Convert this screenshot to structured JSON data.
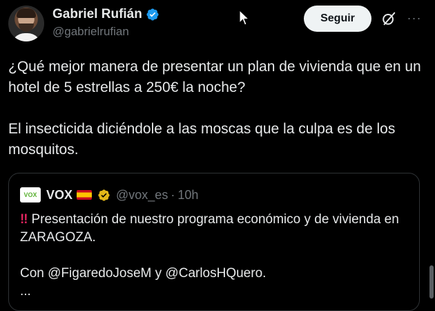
{
  "author": {
    "display_name": "Gabriel Rufián",
    "handle": "@gabrielrufian"
  },
  "actions": {
    "follow_label": "Seguir",
    "more_label": "···"
  },
  "tweet": {
    "paragraph_1": "¿Qué mejor manera de presentar un plan de vivienda que en un hotel de 5 estrellas a 250€ la noche?",
    "paragraph_2": "El insecticida diciéndole a las moscas que la culpa es de los mosquitos."
  },
  "quote": {
    "logo_text": "VOX",
    "name": "VOX",
    "handle": "@vox_es",
    "separator": "·",
    "time": "10h",
    "emoji": "‼",
    "line_1": "Presentación de nuestro programa económico y de vivienda en ZARAGOZA.",
    "line_2": "Con @FigaredoJoseM y @CarlosHQuero.",
    "line_3": "..."
  },
  "colors": {
    "background": "#000000",
    "text_primary": "#e7e9ea",
    "text_secondary": "#71767b",
    "verified_blue": "#1d9bf0",
    "verified_gold": "#e2b719",
    "button_bg": "#eff3f4",
    "border": "#2f3336"
  },
  "icons": {
    "verified": "verified-badge-icon",
    "grok": "grok-icon",
    "more": "more-icon",
    "cursor": "mouse-cursor-icon",
    "flag": "spain-flag-icon"
  }
}
